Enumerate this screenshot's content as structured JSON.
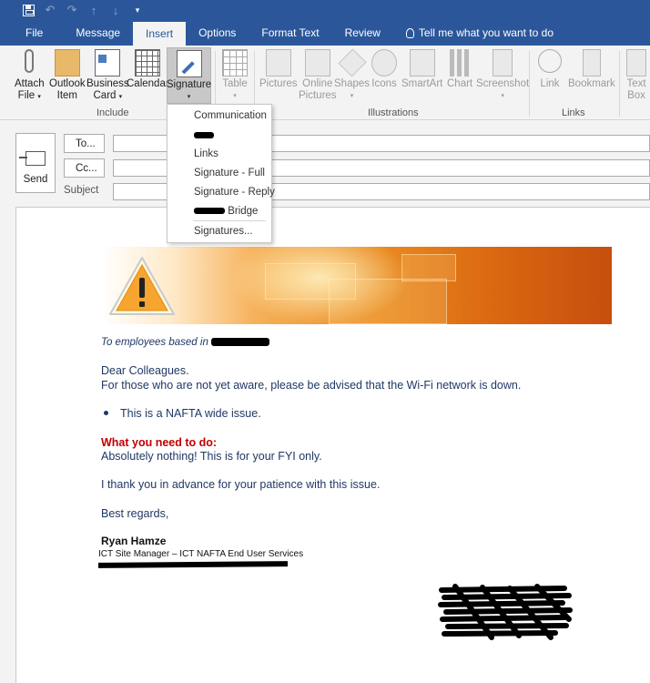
{
  "quick_access": {
    "save": "save-icon",
    "undo": "undo-icon",
    "redo": "redo-icon",
    "up": "up-arrow-icon",
    "down": "down-arrow-icon",
    "customize": "customize-icon"
  },
  "tabs": [
    {
      "label": "File"
    },
    {
      "label": "Message"
    },
    {
      "label": "Insert",
      "active": true
    },
    {
      "label": "Options"
    },
    {
      "label": "Format Text"
    },
    {
      "label": "Review"
    },
    {
      "label": "Tell me what you want to do"
    }
  ],
  "ribbon": {
    "include": {
      "group_label": "Include",
      "attach_file": [
        "Attach",
        "File"
      ],
      "outlook_item": [
        "Outlook",
        "Item"
      ],
      "business_card": [
        "Business",
        "Card"
      ],
      "calendar": "Calendar",
      "signature": "Signature"
    },
    "table": {
      "label": "Table"
    },
    "illustrations": {
      "group_label": "Illustrations",
      "pictures": "Pictures",
      "online_pictures": [
        "Online",
        "Pictures"
      ],
      "shapes": "Shapes",
      "icons": "Icons",
      "smartart": "SmartArt",
      "chart": "Chart",
      "screenshot": "Screenshot"
    },
    "links": {
      "group_label": "Links",
      "link": "Link",
      "bookmark": "Bookmark"
    },
    "text": {
      "text_box": [
        "Text",
        "Box"
      ]
    }
  },
  "signature_menu": {
    "items": [
      "Communication",
      "Links",
      "Signature - Full",
      "Signature - Reply",
      "Bridge"
    ],
    "signatures_command": "Signatures..."
  },
  "compose": {
    "send_label": "Send",
    "to_label": "To...",
    "cc_label": "Cc...",
    "subject_label": "Subject"
  },
  "message": {
    "intro": "To employees based in",
    "greeting": "Dear Colleagues.",
    "line1": "For those who are not yet aware, please be advised that the Wi-Fi network is down.",
    "bullet": "This is a NAFTA wide issue.",
    "what_heading": "What you need to do:",
    "what_text": "Absolutely nothing! This is for your FYI only.",
    "thanks": "I thank you in advance for your patience with this issue.",
    "regards": "Best regards,",
    "sig_name": "Ryan Hamze",
    "sig_title": "ICT Site Manager – ICT NAFTA End User Services"
  },
  "colors": {
    "ribbon_blue": "#2b579a",
    "body_text": "#1f3864",
    "heading_red": "#c00000"
  }
}
